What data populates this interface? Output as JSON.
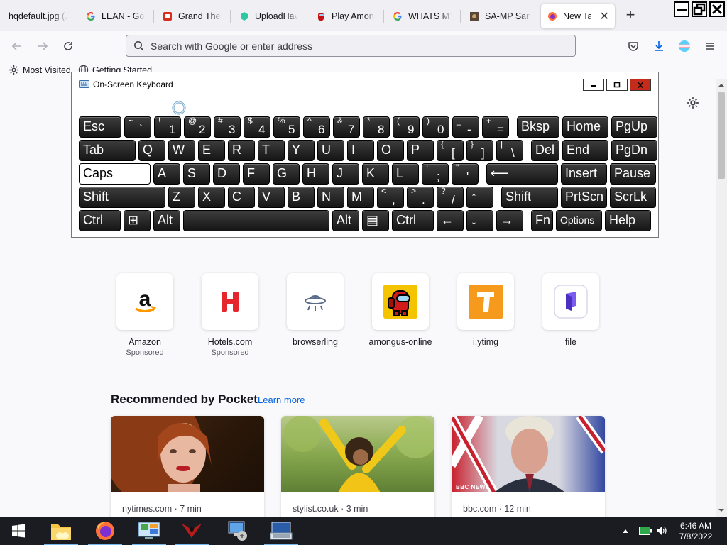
{
  "browser": {
    "tabs": [
      {
        "label": "hqdefault.jpg (JPEG Image",
        "active": false
      },
      {
        "label": "LEAN - Google Search",
        "active": false
      },
      {
        "label": "Grand Theft Auto",
        "active": false
      },
      {
        "label": "UploadHaven",
        "active": false
      },
      {
        "label": "Play Among Us",
        "active": false
      },
      {
        "label": "WHATS MY IP",
        "active": false
      },
      {
        "label": "SA-MP San Andreas",
        "active": false
      },
      {
        "label": "New Tab",
        "active": true
      }
    ],
    "new_tab_symbol": "+",
    "tab_close_symbol": "✕",
    "address_placeholder": "Search with Google or enter address",
    "bookmarks": [
      {
        "label": "Most Visited",
        "icon": "gear-icon"
      },
      {
        "label": "Getting Started",
        "icon": "globe-icon"
      }
    ]
  },
  "newtab": {
    "shortcuts": [
      {
        "name": "Amazon",
        "sub": "Sponsored",
        "icon": "amazon-icon"
      },
      {
        "name": "Hotels.com",
        "sub": "Sponsored",
        "icon": "hotels-icon"
      },
      {
        "name": "browserling",
        "sub": "",
        "icon": "ufo-icon"
      },
      {
        "name": "amongus-online",
        "sub": "",
        "icon": "amongus-icon"
      },
      {
        "name": "i.ytimg",
        "sub": "",
        "icon": "ytimg-icon"
      },
      {
        "name": "file",
        "sub": "",
        "icon": "file-icon"
      }
    ],
    "pocket_title": "Recommended by Pocket",
    "pocket_learn_more": "Learn more",
    "stories": [
      {
        "source": "nytimes.com · 7 min"
      },
      {
        "source": "stylist.co.uk · 3 min"
      },
      {
        "source": "bbc.com · 12 min"
      }
    ],
    "bbc_watermark": "BBC NEWS"
  },
  "osk": {
    "title": "On-Screen Keyboard",
    "rows": [
      [
        {
          "l": "Esc",
          "w": 60
        },
        {
          "t": "~",
          "b": "`",
          "w": 38
        },
        {
          "t": "!",
          "b": "1",
          "w": 38
        },
        {
          "t": "@",
          "b": "2",
          "w": 38
        },
        {
          "t": "#",
          "b": "3",
          "w": 38
        },
        {
          "t": "$",
          "b": "4",
          "w": 38
        },
        {
          "t": "%",
          "b": "5",
          "w": 38
        },
        {
          "t": "^",
          "b": "6",
          "w": 38
        },
        {
          "t": "&",
          "b": "7",
          "w": 38
        },
        {
          "t": "*",
          "b": "8",
          "w": 38
        },
        {
          "t": "(",
          "b": "9",
          "w": 38
        },
        {
          "t": ")",
          "b": "0",
          "w": 38
        },
        {
          "t": "_",
          "b": "-",
          "w": 38
        },
        {
          "t": "+",
          "b": "=",
          "w": 38
        },
        {
          "l": "Bksp",
          "w": 60,
          "gap": 7
        },
        {
          "l": "Home",
          "w": 65
        },
        {
          "l": "PgUp",
          "w": 65
        }
      ],
      [
        {
          "l": "Tab",
          "w": 80
        },
        {
          "l": "Q",
          "w": 38
        },
        {
          "l": "W",
          "w": 38
        },
        {
          "l": "E",
          "w": 38
        },
        {
          "l": "R",
          "w": 38
        },
        {
          "l": "T",
          "w": 38
        },
        {
          "l": "Y",
          "w": 38
        },
        {
          "l": "U",
          "w": 38
        },
        {
          "l": "I",
          "w": 38
        },
        {
          "l": "O",
          "w": 38
        },
        {
          "l": "P",
          "w": 38
        },
        {
          "t": "{",
          "b": "[",
          "w": 38
        },
        {
          "t": "}",
          "b": "]",
          "w": 38
        },
        {
          "t": "|",
          "b": "\\",
          "w": 38
        },
        {
          "l": "Del",
          "w": 40,
          "gap": 7
        },
        {
          "l": "End",
          "w": 65
        },
        {
          "l": "PgDn",
          "w": 65
        }
      ],
      [
        {
          "l": "Caps",
          "w": 101,
          "caps": true
        },
        {
          "l": "A",
          "w": 38
        },
        {
          "l": "S",
          "w": 38
        },
        {
          "l": "D",
          "w": 38
        },
        {
          "l": "F",
          "w": 38
        },
        {
          "l": "G",
          "w": 38
        },
        {
          "l": "H",
          "w": 38
        },
        {
          "l": "J",
          "w": 38
        },
        {
          "l": "K",
          "w": 38
        },
        {
          "l": "L",
          "w": 38
        },
        {
          "t": ":",
          "b": ";",
          "w": 38
        },
        {
          "t": "\"",
          "b": "'",
          "w": 38
        },
        {
          "l": "⟵",
          "w": 101,
          "gap": 7
        },
        {
          "l": "Insert",
          "w": 65
        },
        {
          "l": "Pause",
          "w": 65
        }
      ],
      [
        {
          "l": "Shift",
          "w": 122
        },
        {
          "l": "Z",
          "w": 38
        },
        {
          "l": "X",
          "w": 38
        },
        {
          "l": "C",
          "w": 38
        },
        {
          "l": "V",
          "w": 38
        },
        {
          "l": "B",
          "w": 38
        },
        {
          "l": "N",
          "w": 38
        },
        {
          "l": "M",
          "w": 38
        },
        {
          "t": "<",
          "b": ",",
          "w": 38
        },
        {
          "t": ">",
          "b": ".",
          "w": 38
        },
        {
          "t": "?",
          "b": "/",
          "w": 38
        },
        {
          "l": "↑",
          "w": 38
        },
        {
          "l": "Shift",
          "w": 80,
          "gap": 7
        },
        {
          "l": "PrtScn",
          "w": 65
        },
        {
          "l": "ScrLk",
          "w": 65
        }
      ],
      [
        {
          "l": "Ctrl",
          "w": 59
        },
        {
          "l": "⊞",
          "w": 38
        },
        {
          "l": "Alt",
          "w": 38
        },
        {
          "l": "",
          "w": 206
        },
        {
          "l": "Alt",
          "w": 38
        },
        {
          "l": "▤",
          "w": 38
        },
        {
          "l": "Ctrl",
          "w": 59
        },
        {
          "l": "←",
          "w": 38
        },
        {
          "l": "↓",
          "w": 38
        },
        {
          "l": "→",
          "w": 38
        },
        {
          "l": "Fn",
          "w": 31,
          "gap": 7
        },
        {
          "l": "Options",
          "w": 65,
          "small": true
        },
        {
          "l": "Help",
          "w": 65
        }
      ]
    ]
  },
  "taskbar": {
    "apps": [
      {
        "name": "file-explorer-icon"
      },
      {
        "name": "firefox-icon"
      },
      {
        "name": "control-panel-icon"
      },
      {
        "name": "gta-sa-icon"
      },
      {
        "name": "network-icon"
      },
      {
        "name": "on-screen-keyboard-icon"
      }
    ],
    "time": "6:46 AM",
    "date": "7/8/2022"
  }
}
